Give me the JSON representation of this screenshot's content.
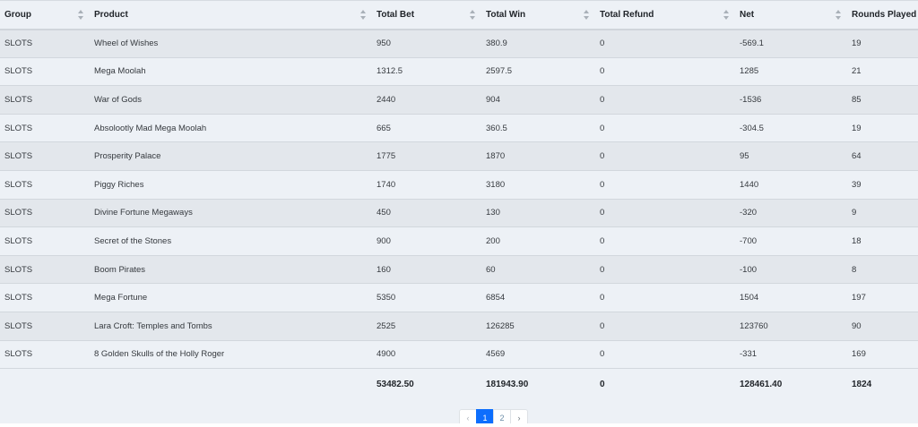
{
  "table": {
    "headers": [
      {
        "key": "group",
        "label": "Group",
        "sortable": true
      },
      {
        "key": "product",
        "label": "Product",
        "sortable": true
      },
      {
        "key": "total_bet",
        "label": "Total Bet",
        "sortable": true
      },
      {
        "key": "total_win",
        "label": "Total Win",
        "sortable": true
      },
      {
        "key": "total_refund",
        "label": "Total Refund",
        "sortable": true
      },
      {
        "key": "net",
        "label": "Net",
        "sortable": true
      },
      {
        "key": "rounds_played",
        "label": "Rounds Played",
        "sortable": false
      }
    ],
    "rows": [
      [
        "SLOTS",
        "Wheel of Wishes",
        "950",
        "380.9",
        "0",
        "-569.1",
        "19"
      ],
      [
        "SLOTS",
        "Mega Moolah",
        "1312.5",
        "2597.5",
        "0",
        "1285",
        "21"
      ],
      [
        "SLOTS",
        "War of Gods",
        "2440",
        "904",
        "0",
        "-1536",
        "85"
      ],
      [
        "SLOTS",
        "Absolootly Mad Mega Moolah",
        "665",
        "360.5",
        "0",
        "-304.5",
        "19"
      ],
      [
        "SLOTS",
        "Prosperity Palace",
        "1775",
        "1870",
        "0",
        "95",
        "64"
      ],
      [
        "SLOTS",
        "Piggy Riches",
        "1740",
        "3180",
        "0",
        "1440",
        "39"
      ],
      [
        "SLOTS",
        "Divine Fortune Megaways",
        "450",
        "130",
        "0",
        "-320",
        "9"
      ],
      [
        "SLOTS",
        "Secret of the Stones",
        "900",
        "200",
        "0",
        "-700",
        "18"
      ],
      [
        "SLOTS",
        "Boom Pirates",
        "160",
        "60",
        "0",
        "-100",
        "8"
      ],
      [
        "SLOTS",
        "Mega Fortune",
        "5350",
        "6854",
        "0",
        "1504",
        "197"
      ],
      [
        "SLOTS",
        "Lara Croft: Temples and Tombs",
        "2525",
        "126285",
        "0",
        "123760",
        "90"
      ],
      [
        "SLOTS",
        "8 Golden Skulls of the Holly Roger",
        "4900",
        "4569",
        "0",
        "-331",
        "169"
      ]
    ],
    "totals": [
      "",
      "",
      "53482.50",
      "181943.90",
      "0",
      "128461.40",
      "1824"
    ]
  },
  "pagination": {
    "prev": "‹",
    "pages": [
      "1",
      "2"
    ],
    "active_page": "1",
    "next": "›"
  },
  "colors": {
    "background": "#edf1f6",
    "row_striped": "#e3e7ec",
    "active_page": "#0d6efd"
  }
}
